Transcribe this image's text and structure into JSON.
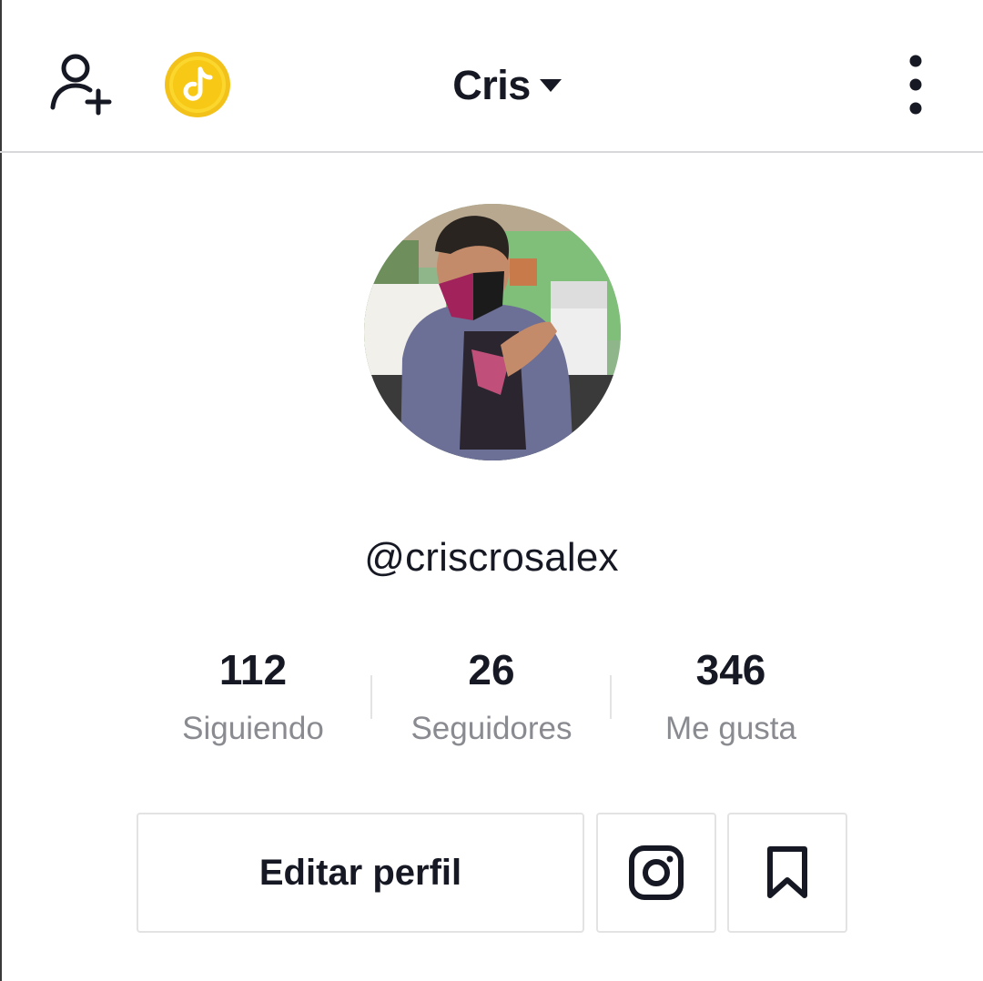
{
  "header": {
    "title": "Cris",
    "icons": {
      "add_user": "add-user-icon",
      "coins": "tiktok-coin-icon",
      "switch_account": "caret-down-icon",
      "more": "more-vertical-icon"
    }
  },
  "profile": {
    "username": "@criscrosalex",
    "avatar": "profile-photo"
  },
  "stats": [
    {
      "value": "112",
      "label": "Siguiendo"
    },
    {
      "value": "26",
      "label": "Seguidores"
    },
    {
      "value": "346",
      "label": "Me gusta"
    }
  ],
  "actions": {
    "edit_label": "Editar perfil",
    "instagram_icon": "instagram-icon",
    "bookmark_icon": "bookmark-icon"
  },
  "colors": {
    "text": "#161823",
    "secondary_text": "#8a8b91",
    "coin": "#f7c815",
    "border": "#e3e3e4"
  }
}
